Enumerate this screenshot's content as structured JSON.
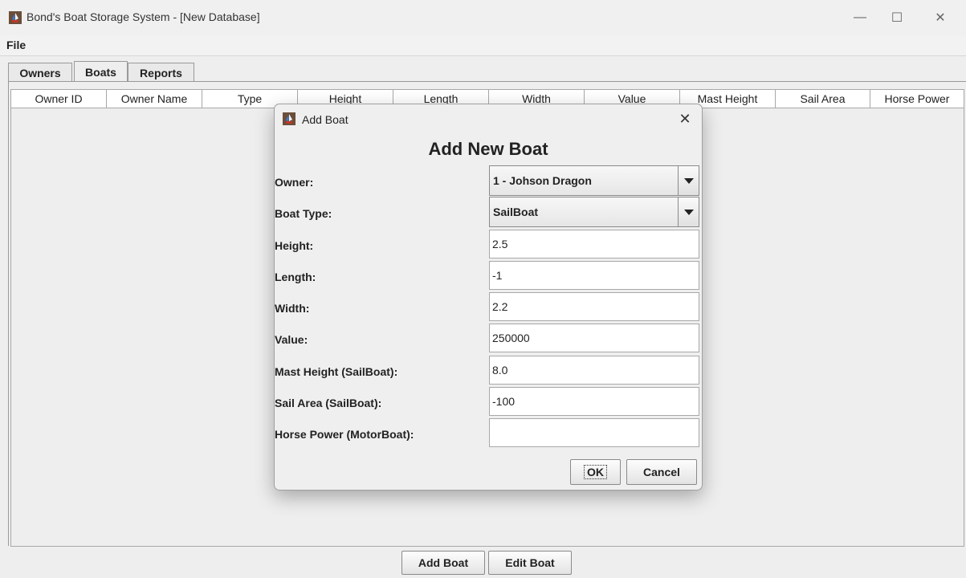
{
  "window": {
    "title": "Bond's Boat Storage System - [New Database]",
    "minimize_glyph": "—",
    "maximize_glyph": "☐",
    "close_glyph": "✕"
  },
  "menubar": {
    "file_label": "File"
  },
  "tabs": [
    {
      "label": "Owners",
      "selected": false
    },
    {
      "label": "Boats",
      "selected": true
    },
    {
      "label": "Reports",
      "selected": false
    }
  ],
  "table": {
    "columns": [
      "Owner ID",
      "Owner Name",
      "Type",
      "Height",
      "Length",
      "Width",
      "Value",
      "Mast Height",
      "Sail Area",
      "Horse Power"
    ],
    "rows": []
  },
  "bottom_buttons": {
    "add_label": "Add Boat",
    "edit_label": "Edit Boat"
  },
  "dialog": {
    "title": "Add Boat",
    "close_glyph": "✕",
    "heading": "Add New Boat",
    "owner": {
      "label": "Owner:",
      "value": "1 - Johson Dragon"
    },
    "boat_type": {
      "label": "Boat Type:",
      "value": "SailBoat"
    },
    "fields": [
      {
        "label": "Height:",
        "value": "2.5"
      },
      {
        "label": "Length:",
        "value": "-1"
      },
      {
        "label": "Width:",
        "value": "2.2"
      },
      {
        "label": "Value:",
        "value": "250000"
      },
      {
        "label": "Mast Height (SailBoat):",
        "value": "8.0"
      },
      {
        "label": "Sail Area (SailBoat):",
        "value": "-100"
      },
      {
        "label": "Horse Power (MotorBoat):",
        "value": ""
      }
    ],
    "ok_label": "OK",
    "cancel_label": "Cancel"
  },
  "icons": {
    "app": "boat-app-icon",
    "dropdown": "chevron-down-icon"
  },
  "colors": {
    "window_bg": "#eeeeee",
    "table_header_bg": "#ffffff",
    "border": "#a8a8a8"
  }
}
